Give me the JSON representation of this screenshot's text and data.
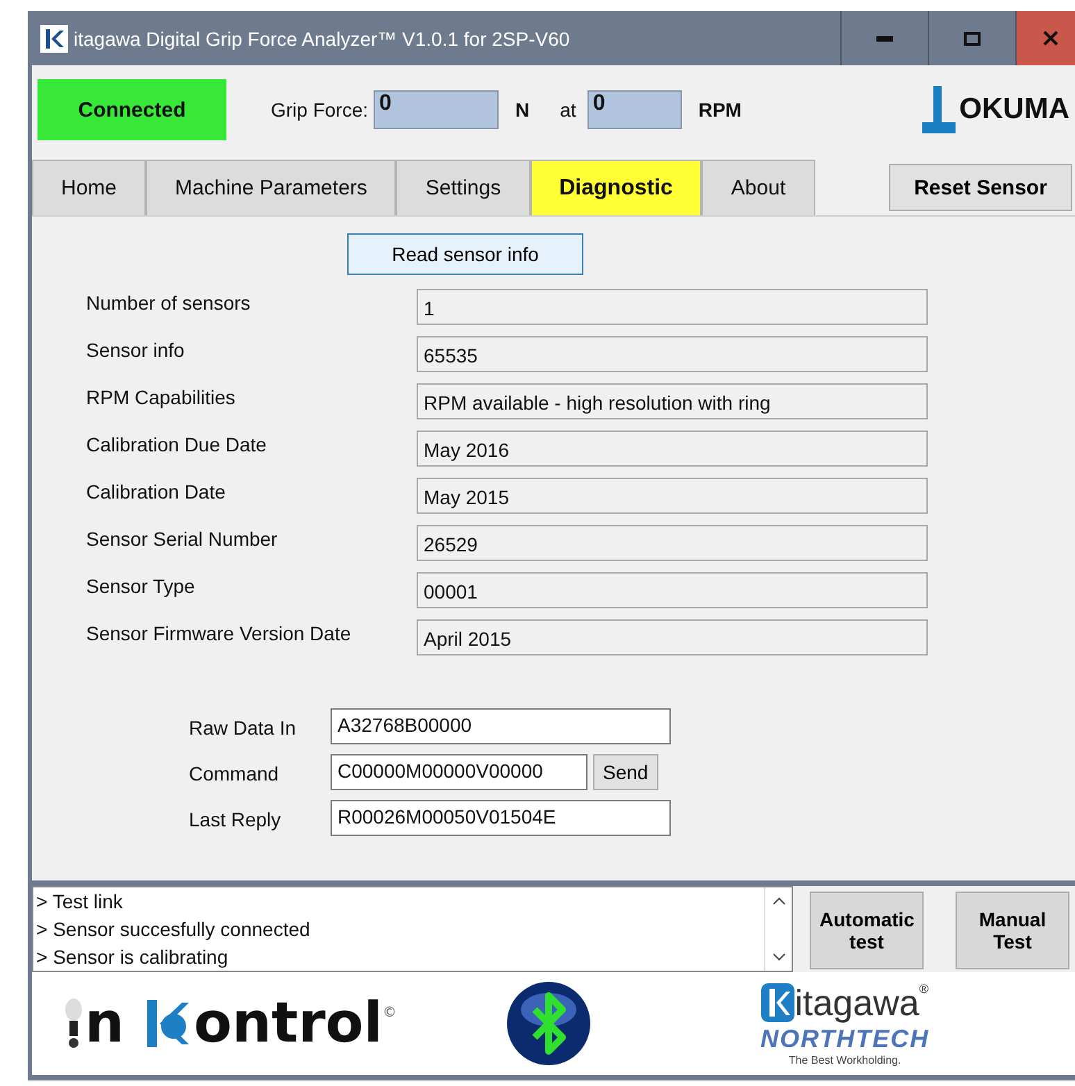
{
  "window": {
    "title": "itagawa Digital Grip Force Analyzer™ V1.0.1 for 2SP-V60"
  },
  "header": {
    "status": "Connected",
    "grip_label": "Grip Force:",
    "grip_value": "0",
    "grip_unit": "N",
    "at_label": "at",
    "rpm_value": "0",
    "rpm_unit": "RPM",
    "brand": "OKUMA"
  },
  "tabs": [
    {
      "label": "Home",
      "selected": false
    },
    {
      "label": "Machine Parameters",
      "selected": false
    },
    {
      "label": "Settings",
      "selected": false
    },
    {
      "label": "Diagnostic",
      "selected": true
    },
    {
      "label": "About",
      "selected": false
    }
  ],
  "reset_button": "Reset Sensor",
  "read_button": "Read sensor info",
  "info_rows": [
    {
      "label": "Number of sensors",
      "value": "1"
    },
    {
      "label": "Sensor info",
      "value": "65535"
    },
    {
      "label": "RPM Capabilities",
      "value": "RPM available - high resolution with ring"
    },
    {
      "label": "Calibration Due Date",
      "value": "May 2016"
    },
    {
      "label": "Calibration Date",
      "value": "May 2015"
    },
    {
      "label": "Sensor Serial Number",
      "value": "26529"
    },
    {
      "label": "Sensor Type",
      "value": "00001"
    },
    {
      "label": "Sensor Firmware Version Date",
      "value": "April 2015"
    }
  ],
  "raw": [
    {
      "label": "Raw Data In",
      "value": "A32768B00000"
    },
    {
      "label": "Command",
      "value": "C00000M00000V00000",
      "button": "Send"
    },
    {
      "label": "Last Reply",
      "value": "R00026M00050V01504E"
    }
  ],
  "log": [
    "> Test link",
    "> Sensor succesfully connected",
    "> Sensor is calibrating"
  ],
  "test_buttons": [
    "Automatic test",
    "Manual Test"
  ],
  "footer": {
    "kontrol_a": "n",
    "kontrol_b": "ontrol",
    "kontrol_mark": "©",
    "kitagawa": "itagawa",
    "kitagawa_mark": "®",
    "northtech": "NORTHTECH",
    "slogan": "The Best Workholding."
  }
}
